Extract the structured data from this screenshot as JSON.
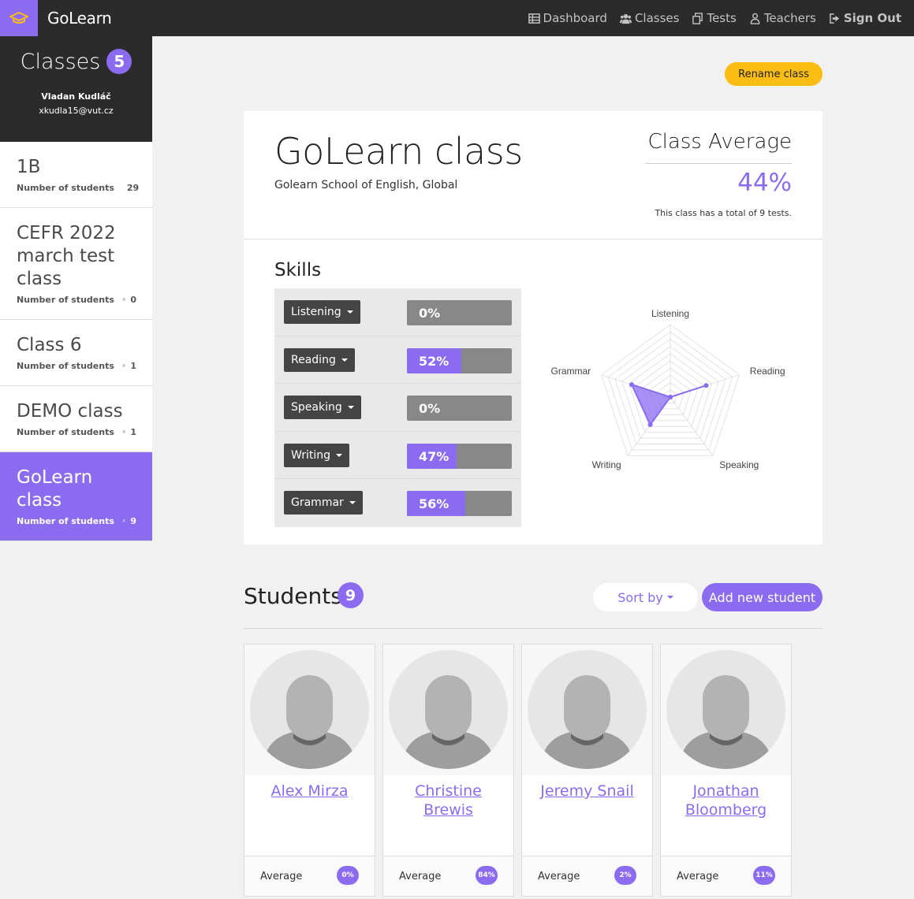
{
  "app": {
    "brand": "GoLearn",
    "logo_icon": "graduation-cap-icon",
    "accent_color": "#8b6cf0",
    "warning_color": "#fbbd13"
  },
  "nav": [
    {
      "label": "Dashboard",
      "icon": "table-icon"
    },
    {
      "label": "Classes",
      "icon": "users-icon"
    },
    {
      "label": "Tests",
      "icon": "copy-icon"
    },
    {
      "label": "Teachers",
      "icon": "teacher-icon"
    },
    {
      "label": "Sign Out",
      "icon": "sign-out-icon"
    }
  ],
  "sidebar": {
    "title": "Classes",
    "count": "5",
    "user_name": "Vladan Kudláč",
    "user_email": "xkudla15@vut.cz",
    "students_label": "Number of students",
    "classes": [
      {
        "name": "1B",
        "students": "29",
        "active": false
      },
      {
        "name": "CEFR 2022 march test class",
        "students": "0",
        "active": false
      },
      {
        "name": "Class 6",
        "students": "1",
        "active": false
      },
      {
        "name": "DEMO class",
        "students": "1",
        "active": false
      },
      {
        "name": "GoLearn class",
        "students": "9",
        "active": true
      }
    ]
  },
  "main": {
    "rename_label": "Rename class",
    "class_title": "GoLearn class",
    "school": "Golearn School of English, Global",
    "average_title": "Class Average",
    "average_value": "44%",
    "average_note": "This class has a total of 9 tests.",
    "skills_title": "Skills",
    "skills": [
      {
        "name": "Listening",
        "pct_label": "0%",
        "fill": 0.0
      },
      {
        "name": "Reading",
        "pct_label": "52%",
        "fill": 0.52
      },
      {
        "name": "Speaking",
        "pct_label": "0%",
        "fill": 0.0
      },
      {
        "name": "Writing",
        "pct_label": "47%",
        "fill": 0.47
      },
      {
        "name": "Grammar",
        "pct_label": "56%",
        "fill": 0.56
      }
    ]
  },
  "chart_data": {
    "type": "radar",
    "categories": [
      "Listening",
      "Reading",
      "Speaking",
      "Writing",
      "Grammar"
    ],
    "values": [
      0,
      52,
      0,
      47,
      56
    ],
    "rlim": [
      0,
      100
    ],
    "grid": true
  },
  "students": {
    "title": "Students",
    "count": "9",
    "sort_label": "Sort by",
    "add_label": "Add new student",
    "average_label": "Average",
    "items": [
      {
        "name": "Alex Mirza",
        "average": "0%"
      },
      {
        "name": "Christine Brewis",
        "average": "84%"
      },
      {
        "name": "Jeremy Snail",
        "average": "2%"
      },
      {
        "name": "Jonathan Bloomberg",
        "average": "11%"
      }
    ]
  }
}
